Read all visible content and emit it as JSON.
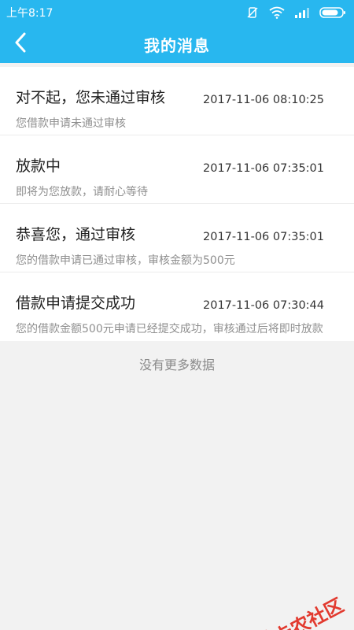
{
  "status_bar": {
    "time": "上午8:17",
    "icons": [
      "vibrate-off-icon",
      "wifi-icon",
      "signal-icon",
      "battery-icon"
    ]
  },
  "header": {
    "title": "我的消息",
    "back_icon": "chevron-left-icon"
  },
  "messages": [
    {
      "title": "对不起，您未通过审核",
      "time": "2017-11-06 08:10:25",
      "desc": "您借款申请未通过审核"
    },
    {
      "title": "放款中",
      "time": "2017-11-06 07:35:01",
      "desc": "即将为您放款，请耐心等待"
    },
    {
      "title": "恭喜您，通过审核",
      "time": "2017-11-06 07:35:01",
      "desc": "您的借款申请已通过审核，审核金额为500元"
    },
    {
      "title": "借款申请提交成功",
      "time": "2017-11-06 07:30:44",
      "desc": "您的借款金额500元申请已经提交成功，审核通过后将即时放款"
    }
  ],
  "footer": {
    "no_more": "没有更多数据"
  },
  "watermark": {
    "text": "卡农社区"
  },
  "colors": {
    "header_bg": "#28b7ef",
    "background": "#f2f2f2",
    "watermark": "#e23a2f"
  }
}
